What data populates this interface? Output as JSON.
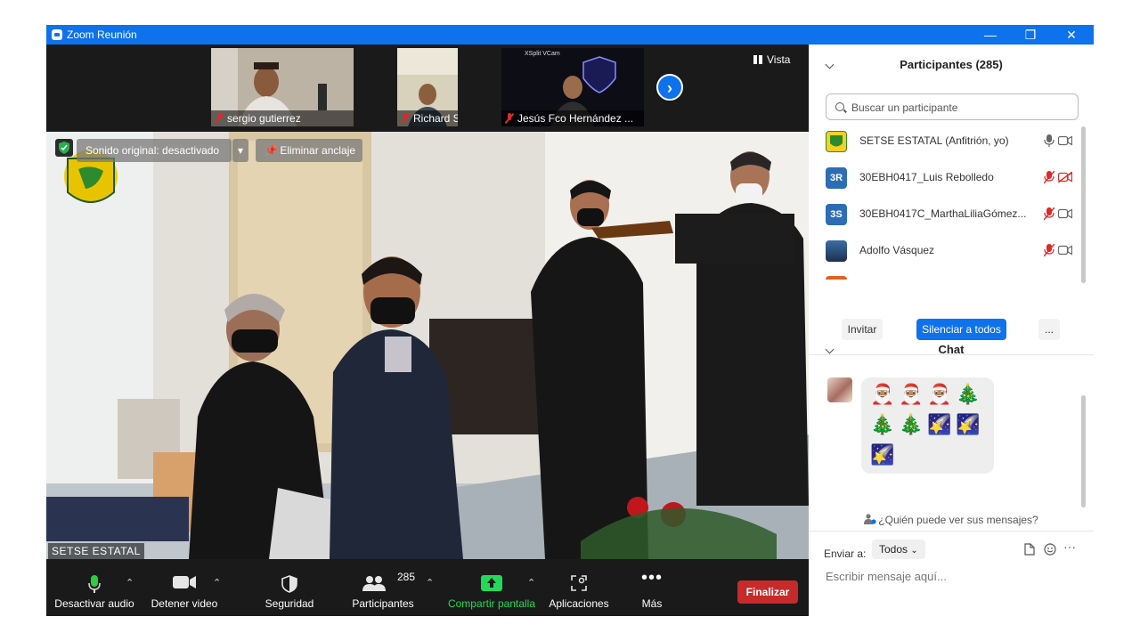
{
  "window": {
    "title": "Zoom Reunión",
    "controls": {
      "minimize": "—",
      "restore": "❐",
      "close": "✕"
    }
  },
  "gallery": {
    "thumbnails": [
      {
        "name": "sergio gutierrez"
      },
      {
        "name": "Richard Santos Pereyra"
      },
      {
        "name": "Jesús Fco Hernández ...",
        "watermark": "XSplit VCam"
      }
    ],
    "view_button": "Vista"
  },
  "main_video": {
    "original_sound": "Sonido original: desactivado",
    "unpin": "Eliminar anclaje",
    "speaker_name": "SETSE ESTATAL"
  },
  "toolbar": {
    "mute_audio": "Desactivar audio",
    "stop_video": "Detener video",
    "security": "Seguridad",
    "participants": "Participantes",
    "participants_count": "285",
    "share_screen": "Compartir pantalla",
    "apps": "Aplicaciones",
    "more": "Más",
    "end": "Finalizar"
  },
  "participants_panel": {
    "title": "Participantes (285)",
    "search_placeholder": "Buscar un participante",
    "list": [
      {
        "name": "SETSE ESTATAL (Anfitrión, yo)",
        "avatar": "",
        "avatar_color": "#f5d020",
        "muted": false,
        "video_off": false
      },
      {
        "name": "30EBH0417_Luis Rebolledo",
        "avatar": "3R",
        "avatar_color": "#2d6db5",
        "muted": true,
        "video_off": true
      },
      {
        "name": "30EBH0417C_MarthaLiliaGómez...",
        "avatar": "3S",
        "avatar_color": "#2d6db5",
        "muted": true,
        "video_off": false
      },
      {
        "name": "Adolfo Vásquez",
        "avatar": "",
        "avatar_color": "#3a6ea5",
        "muted": true,
        "video_off": false
      }
    ],
    "invite": "Invitar",
    "mute_all": "Silenciar a todos",
    "more": "..."
  },
  "chat_panel": {
    "title": "Chat",
    "message_emojis": [
      "🎅🏽",
      "🎅🏽",
      "🎅🏽",
      "🎄",
      "🎄",
      "🎄",
      "🌠",
      "🌠",
      "🌠"
    ],
    "who_can_see": "¿Quién puede ver sus mensajes?",
    "send_to_label": "Enviar a:",
    "send_to_value": "Todos",
    "input_placeholder": "Escribir mensaje aquí..."
  },
  "colors": {
    "zoom_blue": "#0e72ed",
    "end_red": "#c72a2a",
    "share_green": "#23d959",
    "mute_red": "#e02828"
  }
}
